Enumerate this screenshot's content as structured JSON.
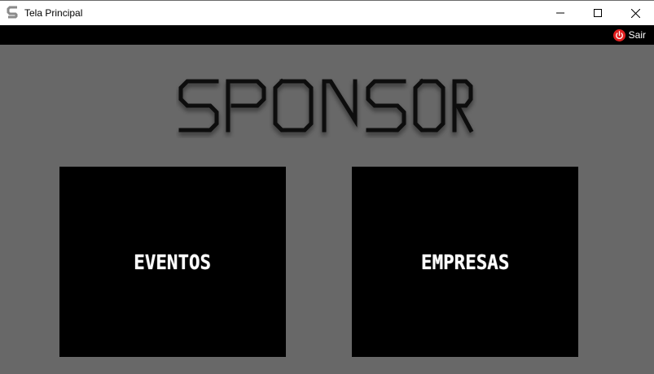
{
  "window": {
    "title": "Tela Principal",
    "app_icon": "s-app-icon",
    "controls": [
      "minimize-icon",
      "maximize-icon",
      "close-icon"
    ]
  },
  "toolbar": {
    "logout_label": "Sair",
    "logout_icon": "power-icon",
    "logout_icon_color": "#e02020"
  },
  "main": {
    "logo_text": "SPONSOR",
    "tiles": [
      {
        "label": "EVENTOS"
      },
      {
        "label": "EMPRESAS"
      }
    ]
  },
  "colors": {
    "background": "#686868",
    "toolbar": "#000000",
    "tile": "#000000",
    "tile_text": "#ffffff",
    "logo": "#0a0a0a"
  }
}
